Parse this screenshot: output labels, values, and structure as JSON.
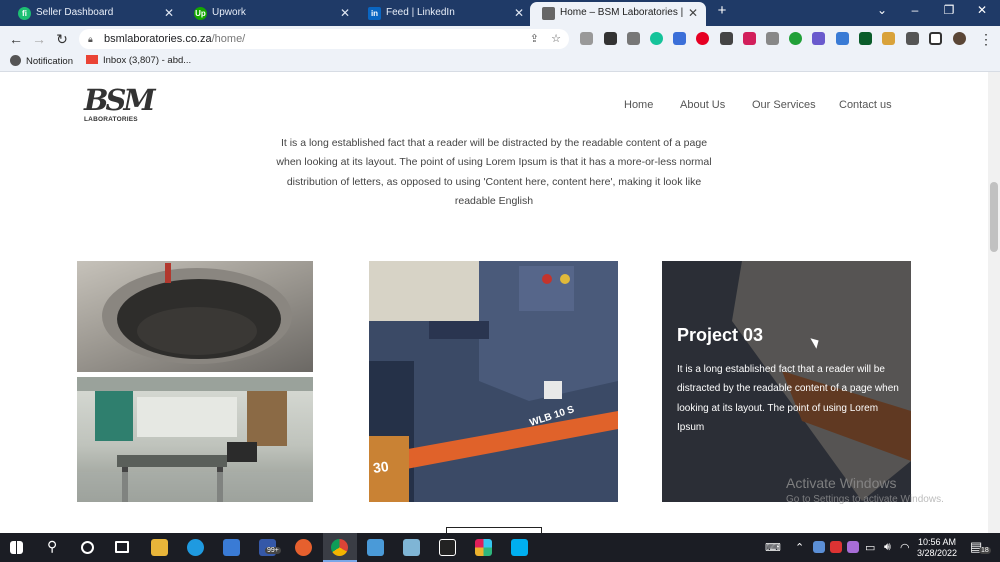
{
  "tabs": [
    {
      "title": "Seller Dashboard",
      "icon": "fiverr-icon",
      "fav_letter": "fi",
      "color": "#1dbf73"
    },
    {
      "title": "Upwork",
      "icon": "upwork-icon",
      "fav_letter": "Up",
      "color": "#14a800"
    },
    {
      "title": "Feed | LinkedIn",
      "icon": "linkedin-icon",
      "fav_letter": "in",
      "color": "#0a66c2"
    },
    {
      "title": "Home – BSM Laboratories |",
      "icon": "bsm-favicon-icon",
      "fav_letter": "",
      "color": "#555555"
    }
  ],
  "new_tab_label": "+",
  "window_controls": {
    "dropdown": "⌄",
    "minimize": "–",
    "restore": "❐",
    "close": "✕"
  },
  "address": {
    "domain": "bsmlaboratories.co.za",
    "path": "/home/"
  },
  "bookmarks": [
    {
      "label": "Notification",
      "icon": "globe-icon"
    },
    {
      "label": "Inbox (3,807) - abd...",
      "icon": "gmail-icon"
    }
  ],
  "site": {
    "logo_text_top": "BSM",
    "logo_text_bottom": "LABORATORIES",
    "nav": [
      "Home",
      "About Us",
      "Our Services",
      "Contact us"
    ],
    "intro": "It is a long established fact that a reader will be distracted by the readable content of a page when looking at its layout. The point of using Lorem Ipsum is that it has a more-or-less normal distribution of letters, as opposed to using 'Content here, content here', making it look like readable English",
    "project": {
      "title": "Project 03",
      "text": "It is a long established fact that a reader will be distracted by the readable content of a page when looking at its layout. The point of using Lorem Ipsum"
    },
    "machine_label": "WLB 10 S",
    "machine_number": "30"
  },
  "watermark": {
    "line1": "Activate Windows",
    "line2": "Go to Settings to activate Windows."
  },
  "taskbar": {
    "badge": "99+",
    "notification_count": "18"
  },
  "clock": {
    "time": "10:56 AM",
    "date": "3/28/2022"
  }
}
